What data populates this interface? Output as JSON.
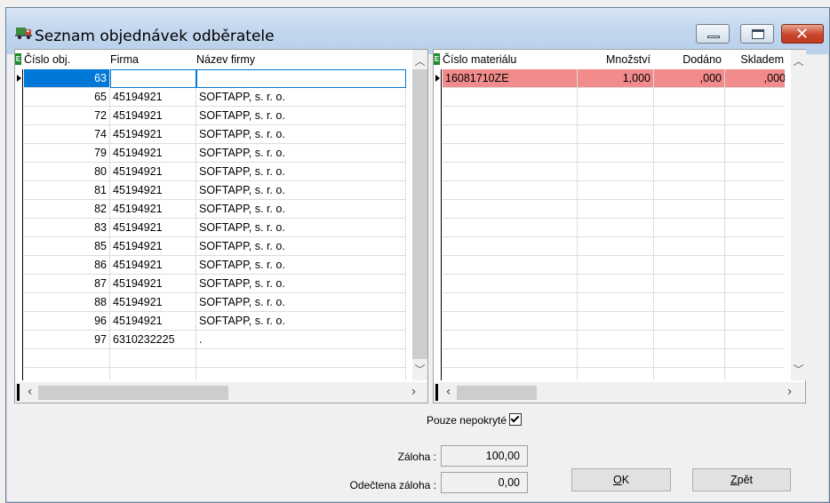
{
  "window": {
    "title": "Seznam objednávek odběratele",
    "icon": "truck-icon",
    "buttons": {
      "minimize": "minimize-icon",
      "maximize": "maximize-icon",
      "close": "close-icon"
    }
  },
  "orders_grid": {
    "header_indicator": "E",
    "columns": [
      "Číslo obj.",
      "Firma",
      "Název firmy"
    ],
    "rows": [
      {
        "cislo": "63",
        "firma": "",
        "nazev": ""
      },
      {
        "cislo": "65",
        "firma": "45194921",
        "nazev": "SOFTAPP, s. r. o."
      },
      {
        "cislo": "72",
        "firma": "45194921",
        "nazev": "SOFTAPP, s. r. o."
      },
      {
        "cislo": "74",
        "firma": "45194921",
        "nazev": "SOFTAPP, s. r. o."
      },
      {
        "cislo": "79",
        "firma": "45194921",
        "nazev": "SOFTAPP, s. r. o."
      },
      {
        "cislo": "80",
        "firma": "45194921",
        "nazev": "SOFTAPP, s. r. o."
      },
      {
        "cislo": "81",
        "firma": "45194921",
        "nazev": "SOFTAPP, s. r. o."
      },
      {
        "cislo": "82",
        "firma": "45194921",
        "nazev": "SOFTAPP, s. r. o."
      },
      {
        "cislo": "83",
        "firma": "45194921",
        "nazev": "SOFTAPP, s. r. o."
      },
      {
        "cislo": "85",
        "firma": "45194921",
        "nazev": "SOFTAPP, s. r. o."
      },
      {
        "cislo": "86",
        "firma": "45194921",
        "nazev": "SOFTAPP, s. r. o."
      },
      {
        "cislo": "87",
        "firma": "45194921",
        "nazev": "SOFTAPP, s. r. o."
      },
      {
        "cislo": "88",
        "firma": "45194921",
        "nazev": "SOFTAPP, s. r. o."
      },
      {
        "cislo": "96",
        "firma": "45194921",
        "nazev": "SOFTAPP, s. r. o."
      },
      {
        "cislo": "97",
        "firma": "6310232225",
        "nazev": "."
      }
    ]
  },
  "items_grid": {
    "header_indicator": "E",
    "columns": [
      "Číslo materiálu",
      "Množství",
      "Dodáno",
      "Skladem"
    ],
    "rows": [
      {
        "material": "16081710ZE",
        "mnozstvi": "1,000",
        "dodano": ",000",
        "skladem": ",000"
      }
    ]
  },
  "footer": {
    "pouze_label": "Pouze nepokryté",
    "pouze_checked": true,
    "zaloha_label": "Záloha :",
    "zaloha_value": "100,00",
    "odectena_label": "Odečtena záloha :",
    "odectena_value": "0,00",
    "ok_label": "OK",
    "zpet_label": "Zpět"
  }
}
